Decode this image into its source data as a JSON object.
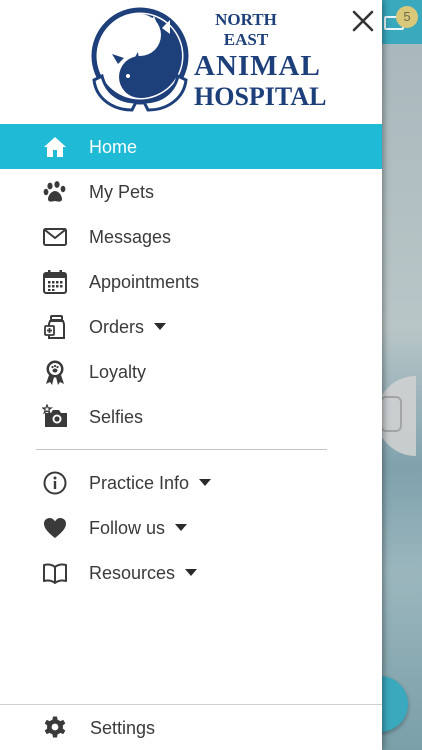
{
  "background": {
    "notification_count": "5"
  },
  "logo": {
    "line1": "NORTH EAST",
    "line2": "ANIMAL",
    "line3": "HOSPITAL",
    "color": "#1d3f7a"
  },
  "colors": {
    "accent": "#1ebad6",
    "text": "#3a3a3a",
    "icon": "#3a3a3a"
  },
  "menu": {
    "items": [
      {
        "label": "Home",
        "icon": "home-icon",
        "active": true
      },
      {
        "label": "My Pets",
        "icon": "paw-icon"
      },
      {
        "label": "Messages",
        "icon": "envelope-icon"
      },
      {
        "label": "Appointments",
        "icon": "calendar-icon"
      },
      {
        "label": "Orders",
        "icon": "medicine-bottle-icon",
        "has_dropdown": true
      },
      {
        "label": "Loyalty",
        "icon": "award-ribbon-icon"
      },
      {
        "label": "Selfies",
        "icon": "camera-icon"
      }
    ]
  },
  "menu2": {
    "items": [
      {
        "label": "Practice Info",
        "icon": "info-icon",
        "has_dropdown": true
      },
      {
        "label": "Follow us",
        "icon": "heart-icon",
        "has_dropdown": true
      },
      {
        "label": "Resources",
        "icon": "book-icon",
        "has_dropdown": true
      }
    ]
  },
  "footer": {
    "settings_label": "Settings",
    "settings_icon": "gear-icon"
  }
}
